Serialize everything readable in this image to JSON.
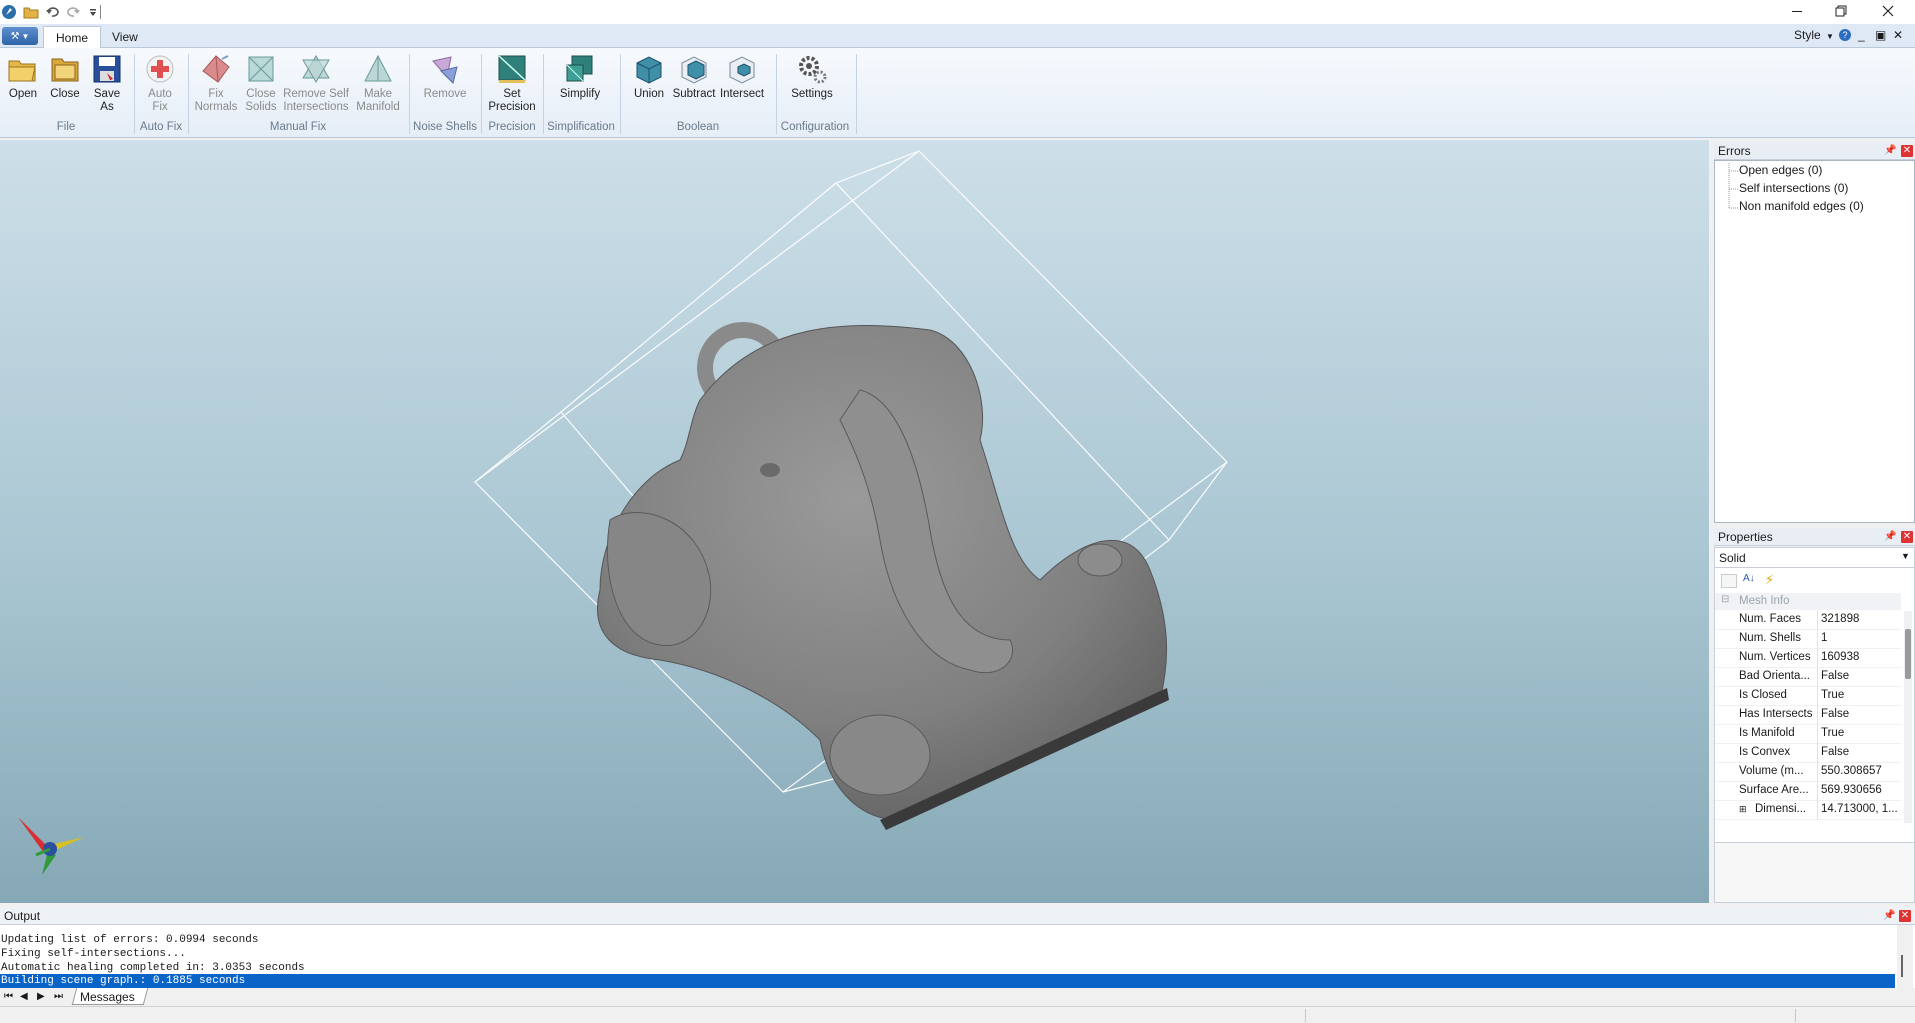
{
  "titlebar": {
    "quick_access_icons": [
      "app-logo-icon",
      "open-folder-icon",
      "undo-icon",
      "redo-icon",
      "customize-icon"
    ],
    "window_controls": [
      "minimize-icon",
      "restore-icon",
      "close-icon"
    ]
  },
  "tabs": {
    "app_menu_icon": "wrench-icon",
    "items": [
      {
        "label": "Home"
      },
      {
        "label": "View"
      }
    ],
    "active": "Home",
    "style_label": "Style",
    "help_glyph": "?"
  },
  "ribbon": {
    "groups": {
      "file": "File",
      "autofix": "Auto Fix",
      "manualfix": "Manual Fix",
      "noise": "Noise Shells",
      "precision": "Precision",
      "simplification": "Simplification",
      "boolean": "Boolean",
      "configuration": "Configuration"
    },
    "buttons": {
      "open": {
        "line1": "Open",
        "line2": ""
      },
      "close": {
        "line1": "Close",
        "line2": ""
      },
      "saveas": {
        "line1": "Save",
        "line2": "As"
      },
      "autofix": {
        "line1": "Auto",
        "line2": "Fix"
      },
      "fixnormals": {
        "line1": "Fix",
        "line2": "Normals"
      },
      "closesolids": {
        "line1": "Close",
        "line2": "Solids"
      },
      "removeself": {
        "line1": "Remove Self",
        "line2": "Intersections"
      },
      "makemanifold": {
        "line1": "Make",
        "line2": "Manifold"
      },
      "remove": {
        "line1": "Remove",
        "line2": ""
      },
      "setprecision": {
        "line1": "Set",
        "line2": "Precision"
      },
      "simplify": {
        "line1": "Simplify",
        "line2": ""
      },
      "union": {
        "line1": "Union",
        "line2": ""
      },
      "subtract": {
        "line1": "Subtract",
        "line2": ""
      },
      "intersect": {
        "line1": "Intersect",
        "line2": ""
      },
      "settings": {
        "line1": "Settings",
        "line2": ""
      }
    }
  },
  "viewport": {
    "model": "elephant pendant mesh",
    "compass_icon": "orientation-compass-icon"
  },
  "errors_panel": {
    "title": "Errors",
    "items": [
      "Open edges (0)",
      "Self intersections (0)",
      "Non manifold edges (0)"
    ]
  },
  "properties_panel": {
    "title": "Properties",
    "selector_value": "Solid",
    "section": "Mesh Info",
    "rows": [
      {
        "key": "Num. Faces",
        "value": "321898"
      },
      {
        "key": "Num. Shells",
        "value": "1"
      },
      {
        "key": "Num. Vertices",
        "value": "160938"
      },
      {
        "key": "Bad Orienta...",
        "value": "False"
      },
      {
        "key": "Is Closed",
        "value": "True"
      },
      {
        "key": "Has Intersects",
        "value": "False"
      },
      {
        "key": "Is Manifold",
        "value": "True"
      },
      {
        "key": "Is Convex",
        "value": "False"
      },
      {
        "key": "Volume (m...",
        "value": "550.308657"
      },
      {
        "key": "Surface Are...",
        "value": "569.930656"
      },
      {
        "key": "Dimensi...",
        "value": "14.713000, 1..."
      }
    ]
  },
  "output_panel": {
    "title": "Output",
    "lines": [
      "Updating list of errors: 0.0994 seconds",
      "Fixing self-intersections...",
      "Automatic healing completed in: 3.0353 seconds",
      "Building scene graph.: 0.1885 seconds"
    ],
    "selected_index": 3,
    "tab_label": "Messages"
  },
  "colors": {
    "accent": "#0a64c8",
    "ribbon_bg": "#e5edf7",
    "viewport_top": "#cddfe8",
    "viewport_bottom": "#86a8b6",
    "close_red": "#d33333"
  }
}
